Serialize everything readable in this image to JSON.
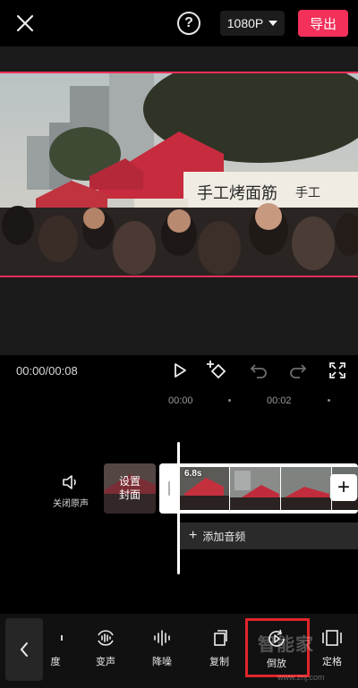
{
  "header": {
    "resolution": "1080P",
    "export_label": "导出",
    "help_label": "?"
  },
  "player": {
    "timecode": "00:00/00:08"
  },
  "video": {
    "sign_text_left": "手工烤面筋",
    "sign_text_right": "手工"
  },
  "timeline": {
    "ruler_labels": [
      "00:00",
      "00:02"
    ],
    "mute_label": "关闭原声",
    "cover_label": "设置\n封面",
    "clip_duration": "6.8s",
    "add_clip_label": "+",
    "add_audio_label": "添加音频"
  },
  "toolbar": {
    "items": [
      {
        "label": "度",
        "icon": "speed-icon"
      },
      {
        "label": "变声",
        "icon": "voice-change-icon"
      },
      {
        "label": "降噪",
        "icon": "noise-reduction-icon"
      },
      {
        "label": "复制",
        "icon": "copy-icon"
      },
      {
        "label": "倒放",
        "icon": "reverse-icon"
      },
      {
        "label": "定格",
        "icon": "freeze-frame-icon"
      }
    ]
  },
  "watermark": {
    "text": "智能家",
    "url": "www.znj.com"
  },
  "colors": {
    "accent": "#f2305a",
    "highlight": "#e0262a",
    "background": "#000000"
  }
}
